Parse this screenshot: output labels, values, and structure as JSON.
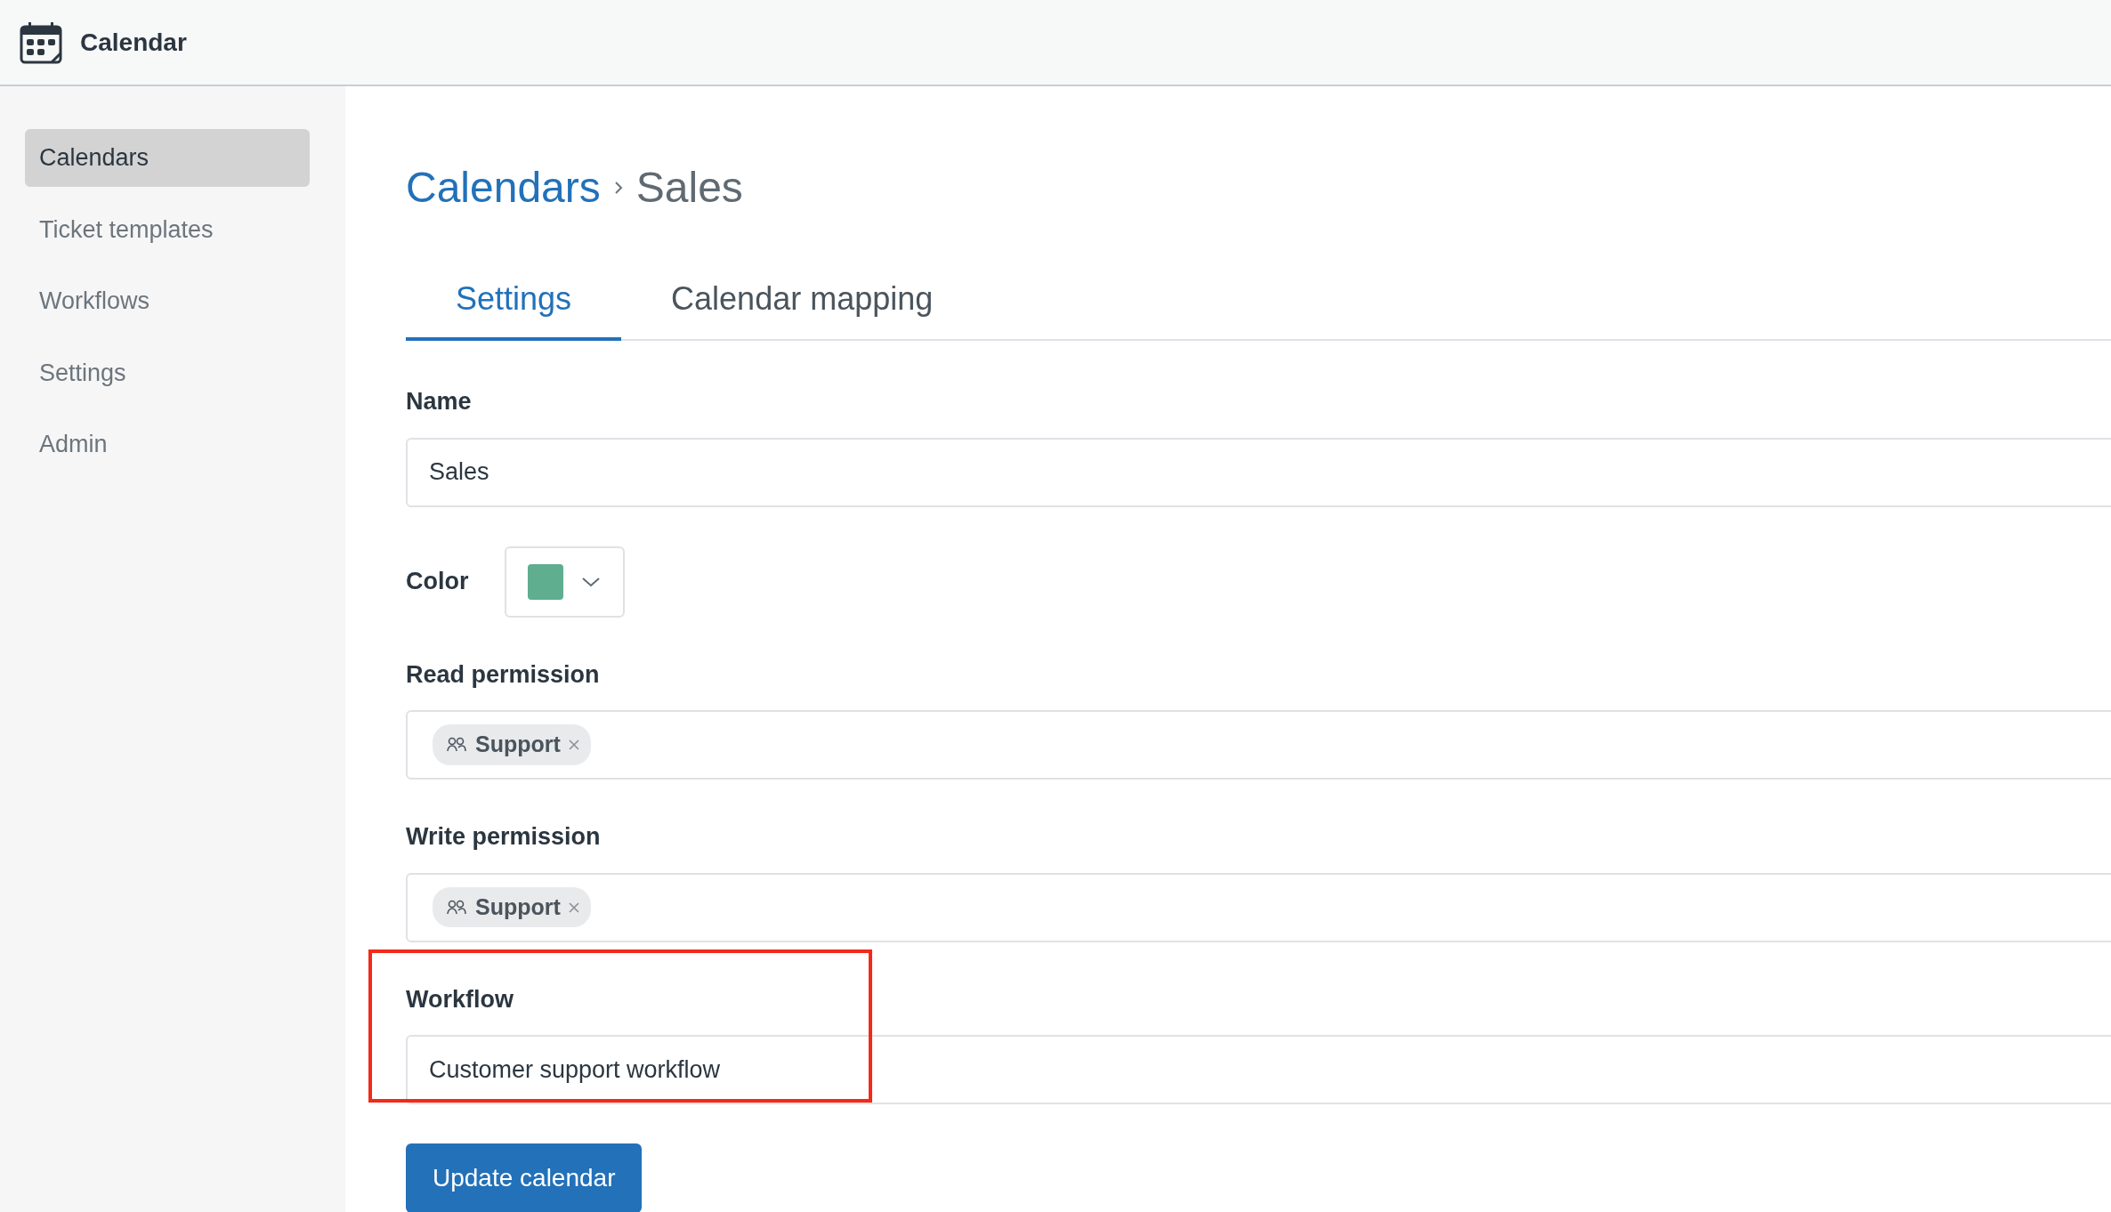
{
  "app": {
    "title": "Calendar"
  },
  "sidebar": {
    "items": [
      {
        "label": "Calendars",
        "selected": true
      },
      {
        "label": "Ticket templates",
        "selected": false
      },
      {
        "label": "Workflows",
        "selected": false
      },
      {
        "label": "Settings",
        "selected": false
      },
      {
        "label": "Admin",
        "selected": false
      }
    ]
  },
  "breadcrumb": [
    {
      "label": "Calendars",
      "kind": "link"
    },
    {
      "label": "Sales",
      "kind": "current"
    }
  ],
  "tabs": [
    {
      "label": "Settings",
      "selected": true
    },
    {
      "label": "Calendar mapping",
      "selected": false
    }
  ],
  "fields": [
    {
      "kind": "text",
      "label": "Name",
      "value": "Sales",
      "highlighted": false
    },
    {
      "kind": "color",
      "label": "Color",
      "color": "#5fae8f",
      "highlighted": false
    },
    {
      "kind": "tags",
      "label": "Read permission",
      "tags": [
        {
          "label": "Support",
          "kind": "group"
        }
      ],
      "highlighted": false
    },
    {
      "kind": "tags",
      "label": "Write permission",
      "tags": [
        {
          "label": "Support",
          "kind": "group"
        }
      ],
      "highlighted": false
    },
    {
      "kind": "text",
      "label": "Workflow",
      "value": "Customer support workflow",
      "highlighted": true
    }
  ],
  "submit": {
    "label": "Update calendar"
  }
}
